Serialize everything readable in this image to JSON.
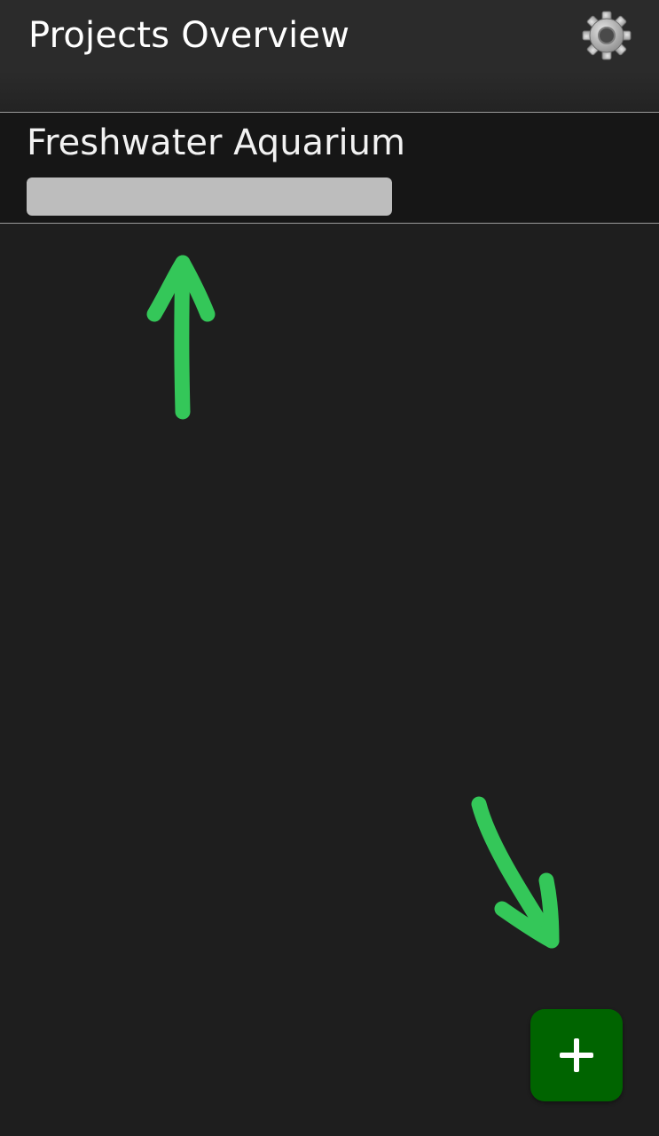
{
  "app_bar": {
    "title": "Projects Overview",
    "settings_icon": "gear-icon"
  },
  "projects": [
    {
      "name": "Freshwater Aquarium",
      "progress": 1.0
    }
  ],
  "fab": {
    "icon": "plus-icon",
    "color": "#006400"
  },
  "annotations": {
    "arrow_color": "#34c759"
  }
}
